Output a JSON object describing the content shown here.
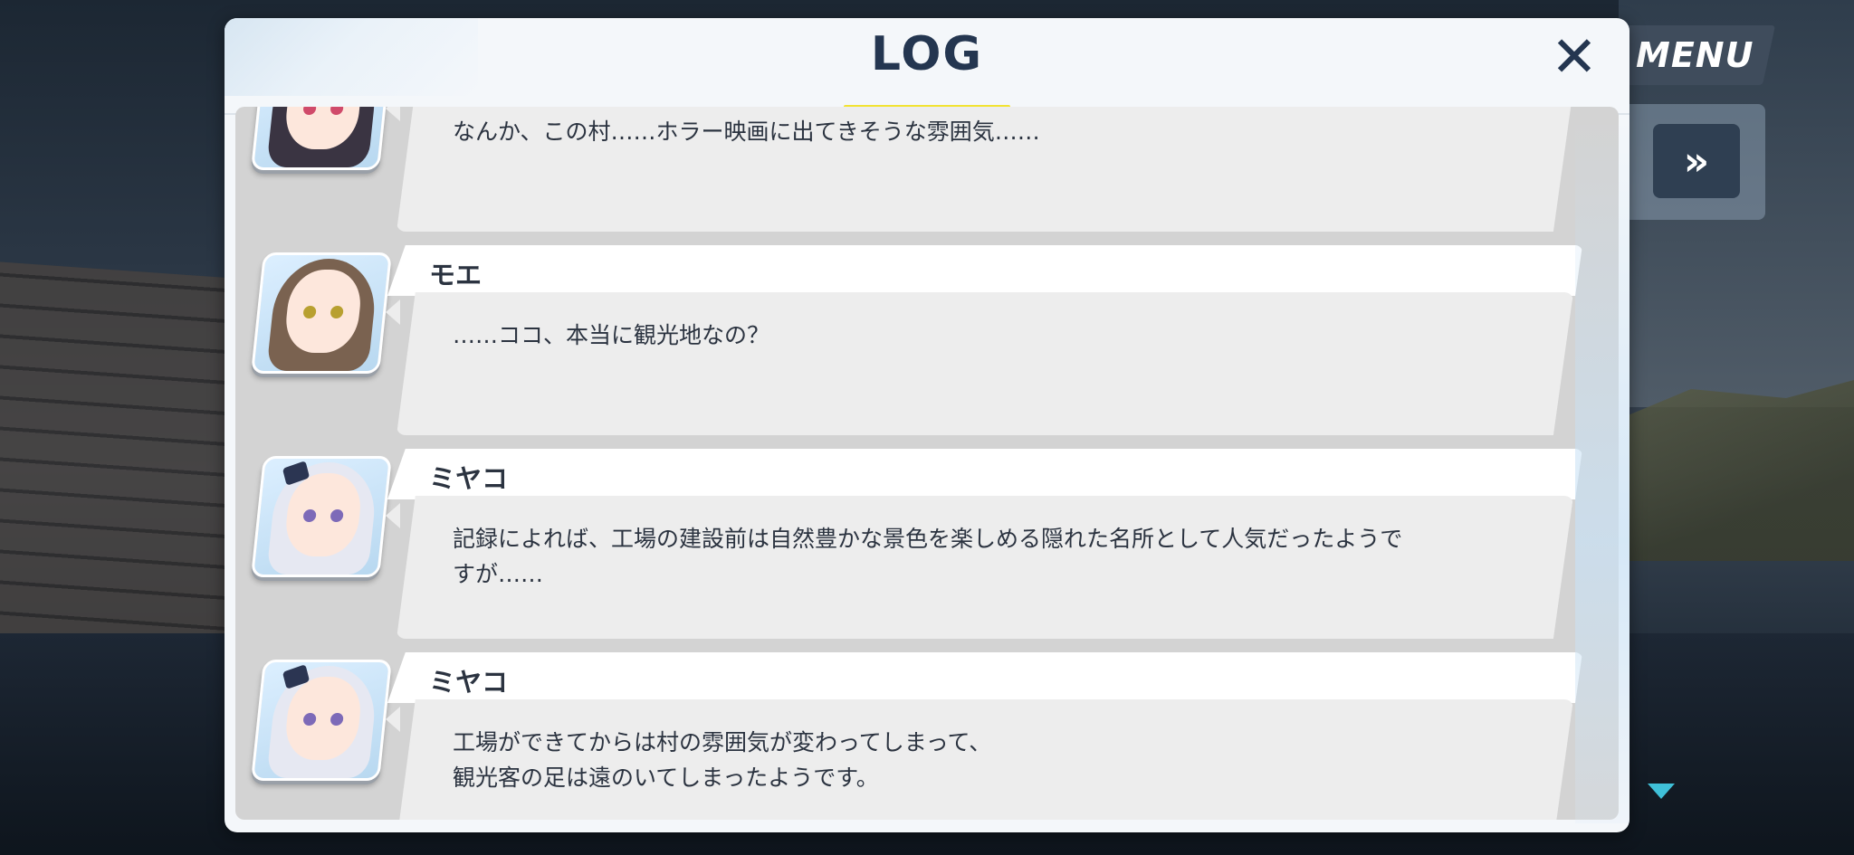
{
  "header": {
    "title": "LOG",
    "close_icon": "close-icon"
  },
  "hud": {
    "menu_label": "MENU",
    "fast_forward_label": "»",
    "scroll_indicator_icon": "triangle-down-icon"
  },
  "log_entries": [
    {
      "speaker": "",
      "portrait": "hoshino-portrait",
      "text": "なんか、この村……ホラー映画に出てきそうな雰囲気……"
    },
    {
      "speaker": "モエ",
      "portrait": "moe-portrait",
      "text": "……ココ、本当に観光地なの？"
    },
    {
      "speaker": "ミヤコ",
      "portrait": "miyako-portrait",
      "text": "記録によれば、工場の建設前は自然豊かな景色を楽しめる隠れた名所として人気だったようで\nすが……"
    },
    {
      "speaker": "ミヤコ",
      "portrait": "miyako-portrait",
      "text": "工場ができてからは村の雰囲気が変わってしまって、\n観光客の足は遠のいてしまったようです。"
    }
  ],
  "colors": {
    "title": "#243650",
    "title_underline": "#f2e333",
    "scroll_indicator": "#3fc0d8"
  }
}
